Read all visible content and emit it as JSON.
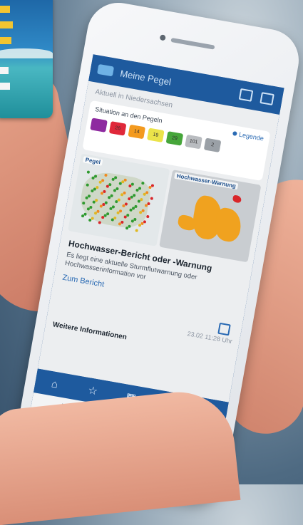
{
  "app": {
    "title": "Meine Pegel",
    "subtitle": "Aktuell in Niedersachsen"
  },
  "situation": {
    "label": "Situation an den Pegeln",
    "legend_label": "Legende",
    "chips": [
      {
        "text": "",
        "color": "#8e2aa0"
      },
      {
        "text": "26",
        "color": "#e0283a"
      },
      {
        "text": "14",
        "color": "#f39a1f"
      },
      {
        "text": "19",
        "color": "#ebe34a"
      },
      {
        "text": "29",
        "color": "#46a63a"
      },
      {
        "text": "101",
        "color": "#b9bcc0"
      },
      {
        "text": "2",
        "color": "#9aa0a6"
      }
    ]
  },
  "maps": {
    "pegel_label": "Pegel",
    "warning_label": "Hochwasser-Warnung"
  },
  "report": {
    "title": "Hochwasser-Bericht oder -Warnung",
    "text": "Es liegt eine aktuelle Sturmflutwarnung oder Hochwasserinformation vor",
    "link": "Zum Bericht",
    "timestamp": "23.02 11:28 Uhr"
  },
  "more_info": "Weitere Informationen",
  "tabbar": [
    "home-icon",
    "star-icon",
    "map-icon",
    "mail-icon",
    "settings-icon"
  ],
  "colors": {
    "brand": "#1e5a9e",
    "link": "#2b6bb4"
  }
}
